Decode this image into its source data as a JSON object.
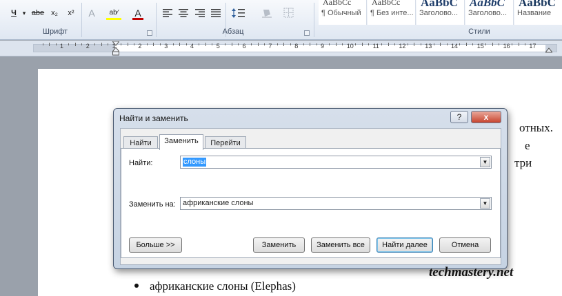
{
  "ribbon": {
    "format_buttons": [
      {
        "icon": "underline-letter-icon",
        "glyph": "Ч"
      },
      {
        "icon": "dropdown-arrow-icon",
        "glyph": "▾"
      },
      {
        "icon": "strikethrough-icon",
        "glyph": "abe"
      },
      {
        "icon": "subscript-icon",
        "glyph": "x₂"
      },
      {
        "icon": "superscript-icon",
        "glyph": "x²"
      },
      {
        "icon": "text-effects-icon",
        "glyph": "A"
      },
      {
        "icon": "highlight-icon",
        "glyph": "ab⁄"
      },
      {
        "icon": "font-color-icon",
        "glyph": "A"
      }
    ],
    "groups": {
      "font": "Шрифт",
      "paragraph": "Абзац",
      "styles": "Стили"
    },
    "styles": [
      {
        "preview": "AaBbCc",
        "name": "¶ Обычный"
      },
      {
        "preview": "AaBbCc",
        "name": "¶ Без инте..."
      },
      {
        "preview": "AaBbC",
        "name": "Заголово..."
      },
      {
        "preview": "AaBbC",
        "name": "Заголово..."
      },
      {
        "preview": "AaBbC",
        "name": "Название"
      }
    ],
    "colors": {
      "highlight": "#ffff00",
      "font_color": "#c00000"
    }
  },
  "ruler": {
    "numbers": [
      "1",
      "2",
      "1",
      "2",
      "3",
      "4",
      "5",
      "6",
      "7",
      "8",
      "9",
      "10",
      "11",
      "12",
      "13",
      "14",
      "15",
      "16",
      "17"
    ]
  },
  "document": {
    "line1": "отных.",
    "line2": "е",
    "line3": "три",
    "bullet": "африканские слоны (Elephas)"
  },
  "dialog": {
    "title": "Найти и заменить",
    "help": "?",
    "close": "x",
    "tabs": [
      "Найти",
      "Заменить",
      "Перейти"
    ],
    "active_tab": "Заменить",
    "find_label": "Найти:",
    "find_value": "слоны",
    "replace_label": "Заменить на:",
    "replace_value": "африканские слоны",
    "buttons": {
      "more": "Больше >>",
      "replace": "Заменить",
      "replace_all": "Заменить все",
      "find_next": "Найти далее",
      "cancel": "Отмена"
    }
  },
  "watermark": "techmastery.net"
}
